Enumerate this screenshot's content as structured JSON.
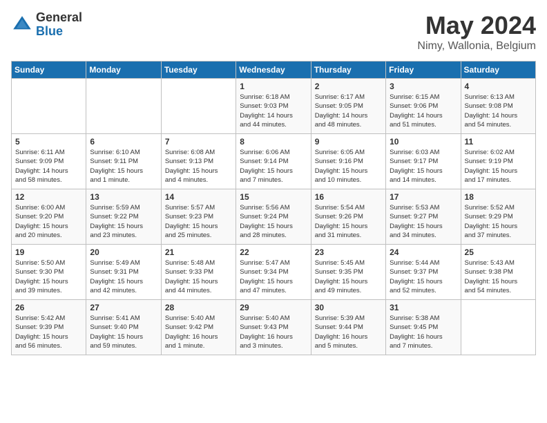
{
  "logo": {
    "general": "General",
    "blue": "Blue"
  },
  "title": {
    "month_year": "May 2024",
    "location": "Nimy, Wallonia, Belgium"
  },
  "headers": [
    "Sunday",
    "Monday",
    "Tuesday",
    "Wednesday",
    "Thursday",
    "Friday",
    "Saturday"
  ],
  "weeks": [
    [
      {
        "day": "",
        "info": ""
      },
      {
        "day": "",
        "info": ""
      },
      {
        "day": "",
        "info": ""
      },
      {
        "day": "1",
        "info": "Sunrise: 6:18 AM\nSunset: 9:03 PM\nDaylight: 14 hours\nand 44 minutes."
      },
      {
        "day": "2",
        "info": "Sunrise: 6:17 AM\nSunset: 9:05 PM\nDaylight: 14 hours\nand 48 minutes."
      },
      {
        "day": "3",
        "info": "Sunrise: 6:15 AM\nSunset: 9:06 PM\nDaylight: 14 hours\nand 51 minutes."
      },
      {
        "day": "4",
        "info": "Sunrise: 6:13 AM\nSunset: 9:08 PM\nDaylight: 14 hours\nand 54 minutes."
      }
    ],
    [
      {
        "day": "5",
        "info": "Sunrise: 6:11 AM\nSunset: 9:09 PM\nDaylight: 14 hours\nand 58 minutes."
      },
      {
        "day": "6",
        "info": "Sunrise: 6:10 AM\nSunset: 9:11 PM\nDaylight: 15 hours\nand 1 minute."
      },
      {
        "day": "7",
        "info": "Sunrise: 6:08 AM\nSunset: 9:13 PM\nDaylight: 15 hours\nand 4 minutes."
      },
      {
        "day": "8",
        "info": "Sunrise: 6:06 AM\nSunset: 9:14 PM\nDaylight: 15 hours\nand 7 minutes."
      },
      {
        "day": "9",
        "info": "Sunrise: 6:05 AM\nSunset: 9:16 PM\nDaylight: 15 hours\nand 10 minutes."
      },
      {
        "day": "10",
        "info": "Sunrise: 6:03 AM\nSunset: 9:17 PM\nDaylight: 15 hours\nand 14 minutes."
      },
      {
        "day": "11",
        "info": "Sunrise: 6:02 AM\nSunset: 9:19 PM\nDaylight: 15 hours\nand 17 minutes."
      }
    ],
    [
      {
        "day": "12",
        "info": "Sunrise: 6:00 AM\nSunset: 9:20 PM\nDaylight: 15 hours\nand 20 minutes."
      },
      {
        "day": "13",
        "info": "Sunrise: 5:59 AM\nSunset: 9:22 PM\nDaylight: 15 hours\nand 23 minutes."
      },
      {
        "day": "14",
        "info": "Sunrise: 5:57 AM\nSunset: 9:23 PM\nDaylight: 15 hours\nand 25 minutes."
      },
      {
        "day": "15",
        "info": "Sunrise: 5:56 AM\nSunset: 9:24 PM\nDaylight: 15 hours\nand 28 minutes."
      },
      {
        "day": "16",
        "info": "Sunrise: 5:54 AM\nSunset: 9:26 PM\nDaylight: 15 hours\nand 31 minutes."
      },
      {
        "day": "17",
        "info": "Sunrise: 5:53 AM\nSunset: 9:27 PM\nDaylight: 15 hours\nand 34 minutes."
      },
      {
        "day": "18",
        "info": "Sunrise: 5:52 AM\nSunset: 9:29 PM\nDaylight: 15 hours\nand 37 minutes."
      }
    ],
    [
      {
        "day": "19",
        "info": "Sunrise: 5:50 AM\nSunset: 9:30 PM\nDaylight: 15 hours\nand 39 minutes."
      },
      {
        "day": "20",
        "info": "Sunrise: 5:49 AM\nSunset: 9:31 PM\nDaylight: 15 hours\nand 42 minutes."
      },
      {
        "day": "21",
        "info": "Sunrise: 5:48 AM\nSunset: 9:33 PM\nDaylight: 15 hours\nand 44 minutes."
      },
      {
        "day": "22",
        "info": "Sunrise: 5:47 AM\nSunset: 9:34 PM\nDaylight: 15 hours\nand 47 minutes."
      },
      {
        "day": "23",
        "info": "Sunrise: 5:45 AM\nSunset: 9:35 PM\nDaylight: 15 hours\nand 49 minutes."
      },
      {
        "day": "24",
        "info": "Sunrise: 5:44 AM\nSunset: 9:37 PM\nDaylight: 15 hours\nand 52 minutes."
      },
      {
        "day": "25",
        "info": "Sunrise: 5:43 AM\nSunset: 9:38 PM\nDaylight: 15 hours\nand 54 minutes."
      }
    ],
    [
      {
        "day": "26",
        "info": "Sunrise: 5:42 AM\nSunset: 9:39 PM\nDaylight: 15 hours\nand 56 minutes."
      },
      {
        "day": "27",
        "info": "Sunrise: 5:41 AM\nSunset: 9:40 PM\nDaylight: 15 hours\nand 59 minutes."
      },
      {
        "day": "28",
        "info": "Sunrise: 5:40 AM\nSunset: 9:42 PM\nDaylight: 16 hours\nand 1 minute."
      },
      {
        "day": "29",
        "info": "Sunrise: 5:40 AM\nSunset: 9:43 PM\nDaylight: 16 hours\nand 3 minutes."
      },
      {
        "day": "30",
        "info": "Sunrise: 5:39 AM\nSunset: 9:44 PM\nDaylight: 16 hours\nand 5 minutes."
      },
      {
        "day": "31",
        "info": "Sunrise: 5:38 AM\nSunset: 9:45 PM\nDaylight: 16 hours\nand 7 minutes."
      },
      {
        "day": "",
        "info": ""
      }
    ]
  ]
}
